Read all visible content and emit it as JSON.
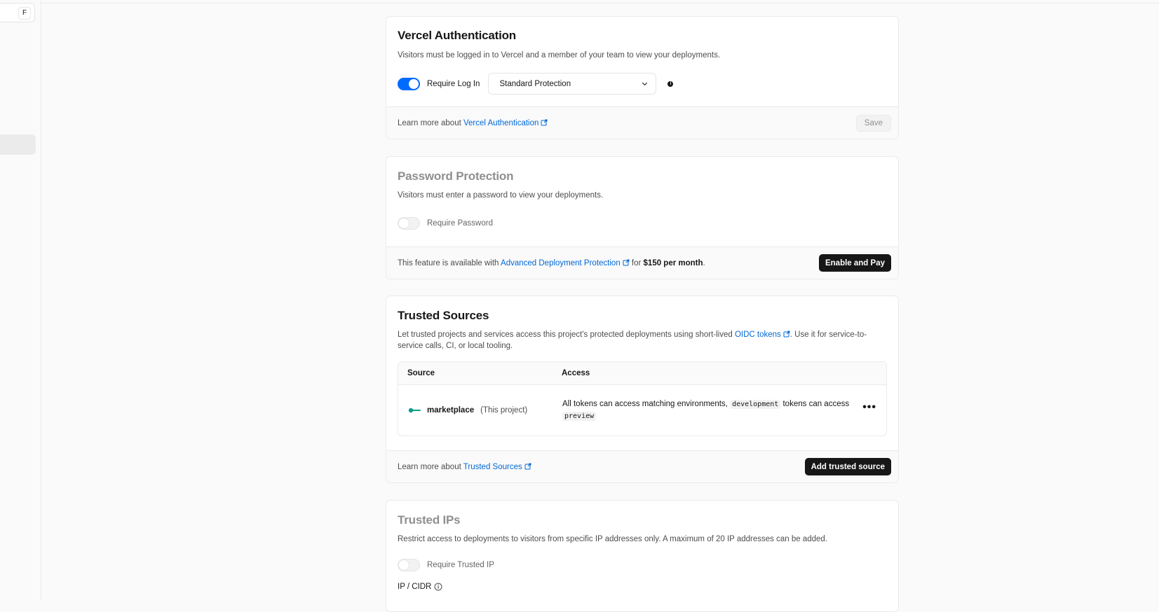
{
  "sidebar": {
    "shortcut_key": "F"
  },
  "vercel_auth": {
    "title": "Vercel Authentication",
    "description": "Visitors must be logged in to Vercel and a member of your team to view your deployments.",
    "toggle_label": "Require Log In",
    "toggle_on": true,
    "select_value": "Standard Protection",
    "info_glyph": "i",
    "footer_prefix": "Learn more about ",
    "footer_link": "Vercel Authentication",
    "save_label": "Save"
  },
  "password_protection": {
    "title": "Password Protection",
    "description": "Visitors must enter a password to view your deployments.",
    "toggle_label": "Require Password",
    "toggle_on": false,
    "footer_prefix": "This feature is available with ",
    "footer_link": "Advanced Deployment Protection",
    "footer_mid": " for ",
    "footer_price": "$150 per month",
    "footer_suffix": ".",
    "button_label": "Enable and Pay"
  },
  "trusted_sources": {
    "title": "Trusted Sources",
    "description_prefix": "Let trusted projects and services access this project's protected deployments using short-lived ",
    "description_link": "OIDC tokens",
    "description_suffix": ". Use it for service-to-service calls, CI, or local tooling.",
    "columns": {
      "source": "Source",
      "access": "Access"
    },
    "rows": [
      {
        "name": "marketplace",
        "tag": "(This project)",
        "access_prefix": "All tokens can access matching environments, ",
        "access_code_1": "development",
        "access_mid": " tokens can access ",
        "access_code_2": "preview"
      }
    ],
    "more_glyph": "•••",
    "footer_prefix": "Learn more about ",
    "footer_link": "Trusted Sources",
    "button_label": "Add trusted source"
  },
  "trusted_ips": {
    "title": "Trusted IPs",
    "description": "Restrict access to deployments to visitors from specific IP addresses only. A maximum of 20 IP addresses can be added.",
    "toggle_label": "Require Trusted IP",
    "toggle_on": false,
    "field_label": "IP / CIDR"
  },
  "colors": {
    "accent": "#006bff",
    "link": "#0068d6",
    "project_icon": "#0a9e8a",
    "dark_button": "#171717"
  },
  "icons": [
    "external-link-icon",
    "chevron-down-icon",
    "info-icon",
    "project-icon",
    "more-horizontal-icon"
  ]
}
